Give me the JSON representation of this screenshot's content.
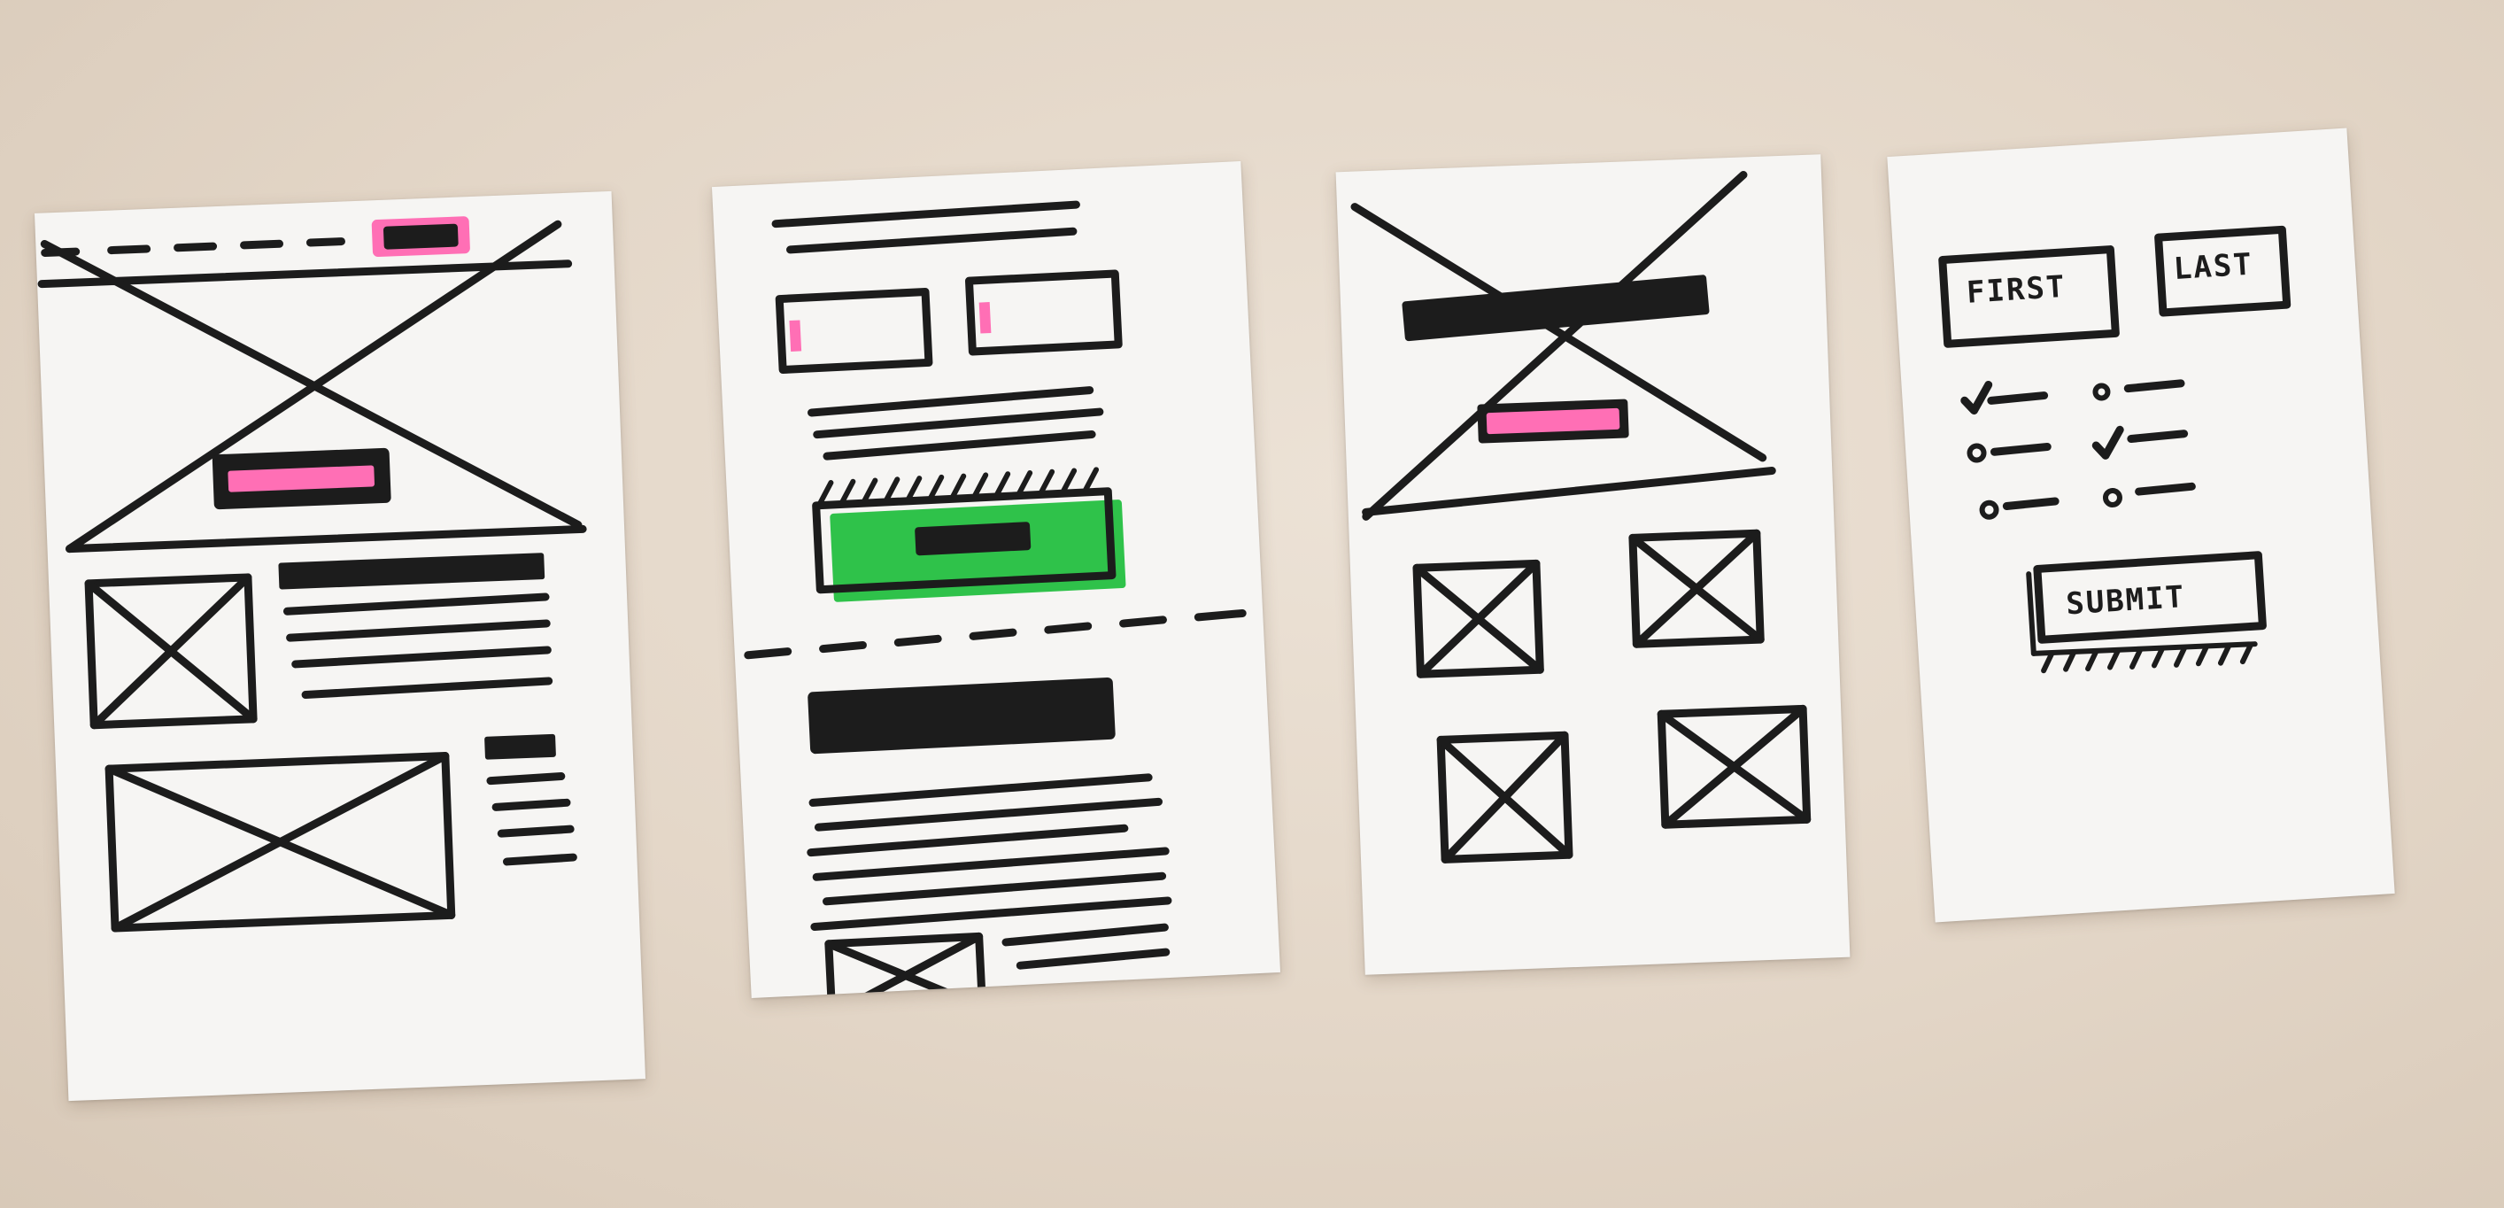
{
  "scene": "paper-wireframe-sketches",
  "colors": {
    "background": "#e6dacb",
    "card": "#f6f5f3",
    "ink": "#1c1c1c",
    "pink": "#ff6fb5",
    "green": "#2fc24a"
  },
  "cards": [
    {
      "id": "card-1-landing-page"
    },
    {
      "id": "card-2-article-page"
    },
    {
      "id": "card-3-gallery-page"
    },
    {
      "id": "card-4-form-page"
    }
  ],
  "form": {
    "first_label": "FIRST",
    "last_label": "LAST",
    "submit_label": "SUBMIT"
  }
}
